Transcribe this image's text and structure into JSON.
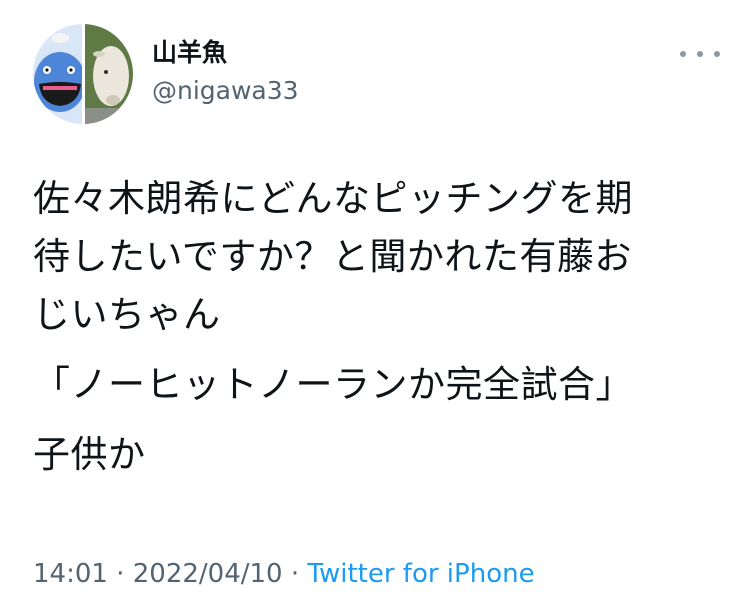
{
  "user": {
    "display_name": "山羊魚",
    "handle": "@nigawa33",
    "avatar_icon": "avatar-split-icon"
  },
  "more_icon": "more-options-icon",
  "tweet": {
    "paragraphs": [
      "佐々木朗希にどんなピッチングを期\n待したいですか？と聞かれた有藤お\nじいちゃん",
      "「ノーヒットノーランか完全試合」",
      "子供か"
    ]
  },
  "meta": {
    "time": "14:01",
    "sep1": " · ",
    "date": "2022/04/10",
    "sep2": " · ",
    "source": "Twitter for iPhone"
  },
  "colors": {
    "text": "#0f1419",
    "muted": "#536471",
    "link": "#1d9bf0"
  }
}
